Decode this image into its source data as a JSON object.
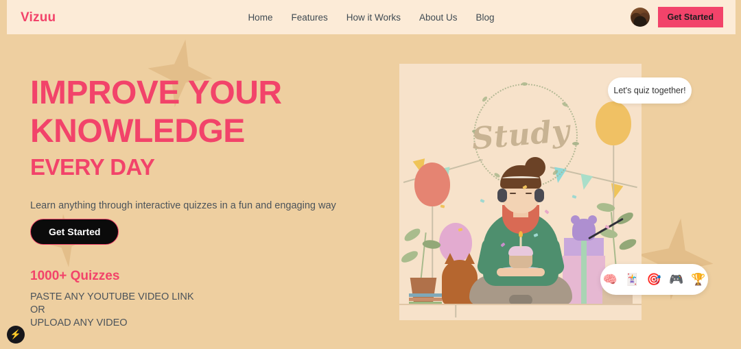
{
  "brand": {
    "logo": "Vizuu"
  },
  "nav": {
    "items": [
      {
        "label": "Home"
      },
      {
        "label": "Features"
      },
      {
        "label": "How it Works"
      },
      {
        "label": "About Us"
      },
      {
        "label": "Blog"
      }
    ],
    "cta_label": "Get Started",
    "avatar_name": "user-avatar"
  },
  "hero": {
    "headline_line1": "IMPROVE YOUR",
    "headline_line2": "KNOWLEDGE",
    "headline_line3": "EVERY DAY",
    "subtitle": "Learn anything through interactive quizzes in a fun and engaging way",
    "cta_label": "Get Started",
    "stat_number": "1000+ Quizzes",
    "stat_desc_line1": "PASTE ANY YOUTUBE VIDEO LINK OR",
    "stat_desc_line2": "UPLOAD ANY VIDEO"
  },
  "card": {
    "study_text": "Study",
    "bubble_text": "Let's quiz together!"
  },
  "icon_pill": {
    "icons": [
      {
        "name": "brain-icon",
        "glyph": "🧠"
      },
      {
        "name": "flashcards-icon",
        "glyph": "🃏"
      },
      {
        "name": "target-icon",
        "glyph": "🎯"
      },
      {
        "name": "gamepad-icon",
        "glyph": "🎮"
      },
      {
        "name": "trophy-icon",
        "glyph": "🏆"
      }
    ]
  },
  "fab": {
    "glyph": "⚡"
  },
  "colors": {
    "background": "#EECFA0",
    "header_bg": "#FCEBD7",
    "accent_pink": "#F2436A",
    "card_bg": "#F7E2CA",
    "text_dark": "#4B535A",
    "star_decor": "#E3BE8A"
  }
}
